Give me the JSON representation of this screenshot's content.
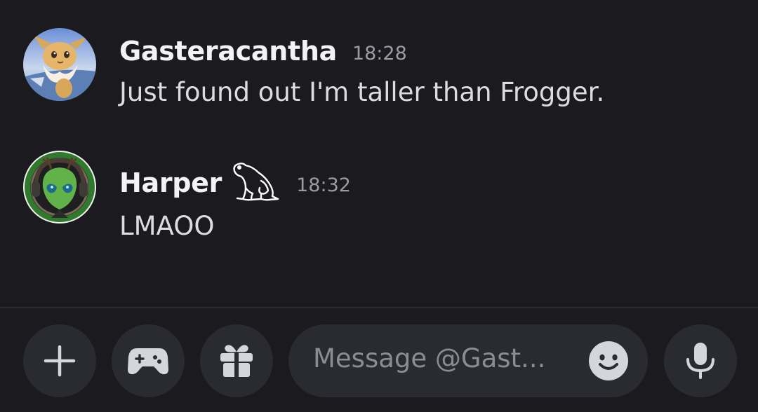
{
  "messages": [
    {
      "username": "Gasteracantha",
      "timestamp": "18:28",
      "text": "Just found out I'm taller than Frogger.",
      "avatar": "eevee-avatar"
    },
    {
      "username": "Harper",
      "timestamp": "18:32",
      "text": "LMAOO",
      "avatar": "alien-avatar",
      "badge": "frog-icon"
    }
  ],
  "composer": {
    "placeholder": "Message @Gast...",
    "buttons": [
      "plus-icon",
      "gamepad-icon",
      "gift-icon",
      "emoji-icon",
      "microphone-icon"
    ]
  },
  "colors": {
    "background": "#1b1b1f",
    "button_bg": "#2a2b31",
    "username": "#f2f3f5",
    "timestamp": "#9a9ca4",
    "message_text": "#dcdde1"
  }
}
